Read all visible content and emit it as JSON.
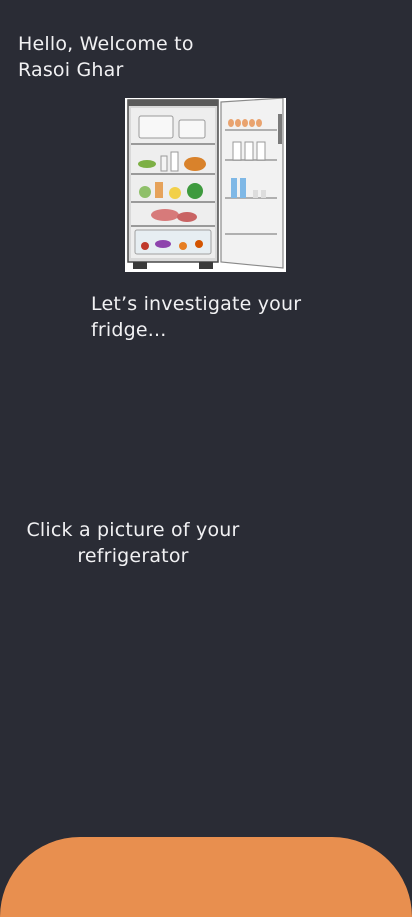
{
  "header": {
    "greeting": "Hello, Welcome to Rasoi Ghar"
  },
  "hero": {
    "image_icon": "open-fridge-illustration",
    "subtitle": "Let’s investigate your fridge..."
  },
  "capture": {
    "prompt": "Click a picture of your refrigerator"
  },
  "colors": {
    "background": "#2a2c35",
    "text": "#f1f1f3",
    "accent": "#e88f4f"
  }
}
